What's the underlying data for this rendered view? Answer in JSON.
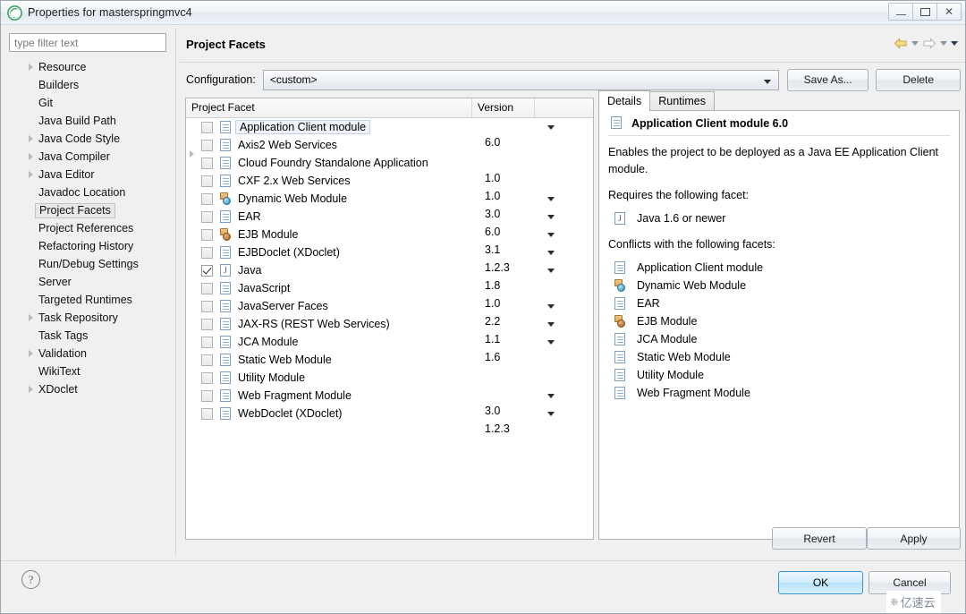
{
  "window": {
    "title": "Properties for masterspringmvc4",
    "app_icon": "eclipse-icon",
    "controls": [
      {
        "name": "minimize-button",
        "glyph": "minimize"
      },
      {
        "name": "maximize-button",
        "glyph": "maximize"
      },
      {
        "name": "close-button",
        "glyph": "close"
      }
    ]
  },
  "sidebar": {
    "filter": {
      "placeholder": "type filter text",
      "value": ""
    },
    "items": [
      {
        "label": "Resource",
        "expandable": true,
        "selected": false
      },
      {
        "label": "Builders",
        "expandable": false,
        "selected": false
      },
      {
        "label": "Git",
        "expandable": false,
        "selected": false
      },
      {
        "label": "Java Build Path",
        "expandable": false,
        "selected": false
      },
      {
        "label": "Java Code Style",
        "expandable": true,
        "selected": false
      },
      {
        "label": "Java Compiler",
        "expandable": true,
        "selected": false
      },
      {
        "label": "Java Editor",
        "expandable": true,
        "selected": false
      },
      {
        "label": "Javadoc Location",
        "expandable": false,
        "selected": false
      },
      {
        "label": "Project Facets",
        "expandable": false,
        "selected": true
      },
      {
        "label": "Project References",
        "expandable": false,
        "selected": false
      },
      {
        "label": "Refactoring History",
        "expandable": false,
        "selected": false
      },
      {
        "label": "Run/Debug Settings",
        "expandable": false,
        "selected": false
      },
      {
        "label": "Server",
        "expandable": false,
        "selected": false
      },
      {
        "label": "Targeted Runtimes",
        "expandable": false,
        "selected": false
      },
      {
        "label": "Task Repository",
        "expandable": true,
        "selected": false
      },
      {
        "label": "Task Tags",
        "expandable": false,
        "selected": false
      },
      {
        "label": "Validation",
        "expandable": true,
        "selected": false
      },
      {
        "label": "WikiText",
        "expandable": false,
        "selected": false
      },
      {
        "label": "XDoclet",
        "expandable": true,
        "selected": false
      }
    ]
  },
  "page": {
    "title": "Project Facets",
    "nav": {
      "back_icon": "back-arrow-icon",
      "back_menu_icon": "chevron-down-icon",
      "forward_icon": "forward-arrow-icon",
      "forward_menu_icon": "chevron-down-icon",
      "view_menu_icon": "chevron-down-icon"
    },
    "configuration": {
      "label": "Configuration:",
      "value": "<custom>",
      "save_as_label": "Save As...",
      "delete_label": "Delete"
    }
  },
  "facet_table": {
    "columns": [
      "Project Facet",
      "Version",
      ""
    ],
    "rows": [
      {
        "name": "Application Client module",
        "version": "6.0",
        "checked": false,
        "icon": "doc",
        "dropdown": true,
        "expandable": false,
        "selected": true
      },
      {
        "name": "Axis2 Web Services",
        "version": "",
        "checked": false,
        "icon": "doc",
        "dropdown": false,
        "expandable": true,
        "selected": false
      },
      {
        "name": "Cloud Foundry Standalone Application",
        "version": "1.0",
        "checked": false,
        "icon": "doc",
        "dropdown": false,
        "expandable": false,
        "selected": false
      },
      {
        "name": "CXF 2.x Web Services",
        "version": "1.0",
        "checked": false,
        "icon": "doc",
        "dropdown": false,
        "expandable": false,
        "selected": false
      },
      {
        "name": "Dynamic Web Module",
        "version": "3.0",
        "checked": false,
        "icon": "web",
        "dropdown": true,
        "expandable": false,
        "selected": false
      },
      {
        "name": "EAR",
        "version": "6.0",
        "checked": false,
        "icon": "doc",
        "dropdown": true,
        "expandable": false,
        "selected": false
      },
      {
        "name": "EJB Module",
        "version": "3.1",
        "checked": false,
        "icon": "ejb",
        "dropdown": true,
        "expandable": false,
        "selected": false
      },
      {
        "name": "EJBDoclet (XDoclet)",
        "version": "1.2.3",
        "checked": false,
        "icon": "doc",
        "dropdown": true,
        "expandable": false,
        "selected": false
      },
      {
        "name": "Java",
        "version": "1.8",
        "checked": true,
        "icon": "java",
        "dropdown": true,
        "expandable": false,
        "selected": false
      },
      {
        "name": "JavaScript",
        "version": "1.0",
        "checked": false,
        "icon": "doc",
        "dropdown": false,
        "expandable": false,
        "selected": false
      },
      {
        "name": "JavaServer Faces",
        "version": "2.2",
        "checked": false,
        "icon": "doc",
        "dropdown": true,
        "expandable": false,
        "selected": false
      },
      {
        "name": "JAX-RS (REST Web Services)",
        "version": "1.1",
        "checked": false,
        "icon": "doc",
        "dropdown": true,
        "expandable": false,
        "selected": false
      },
      {
        "name": "JCA Module",
        "version": "1.6",
        "checked": false,
        "icon": "doc",
        "dropdown": true,
        "expandable": false,
        "selected": false
      },
      {
        "name": "Static Web Module",
        "version": "",
        "checked": false,
        "icon": "doc",
        "dropdown": false,
        "expandable": false,
        "selected": false
      },
      {
        "name": "Utility Module",
        "version": "",
        "checked": false,
        "icon": "doc",
        "dropdown": false,
        "expandable": false,
        "selected": false
      },
      {
        "name": "Web Fragment Module",
        "version": "3.0",
        "checked": false,
        "icon": "doc",
        "dropdown": true,
        "expandable": false,
        "selected": false
      },
      {
        "name": "WebDoclet (XDoclet)",
        "version": "1.2.3",
        "checked": false,
        "icon": "doc",
        "dropdown": true,
        "expandable": false,
        "selected": false
      }
    ]
  },
  "details": {
    "tabs": [
      {
        "label": "Details",
        "active": true
      },
      {
        "label": "Runtimes",
        "active": false
      }
    ],
    "heading": "Application Client module 6.0",
    "heading_icon": "doc",
    "description": "Enables the project to be deployed as a Java EE Application Client module.",
    "requires_label": "Requires the following facet:",
    "requires": [
      {
        "label": "Java 1.6 or newer",
        "icon": "java"
      }
    ],
    "conflicts_label": "Conflicts with the following facets:",
    "conflicts": [
      {
        "label": "Application Client module",
        "icon": "doc"
      },
      {
        "label": "Dynamic Web Module",
        "icon": "web"
      },
      {
        "label": "EAR",
        "icon": "doc"
      },
      {
        "label": "EJB Module",
        "icon": "ejb"
      },
      {
        "label": "JCA Module",
        "icon": "doc"
      },
      {
        "label": "Static Web Module",
        "icon": "doc"
      },
      {
        "label": "Utility Module",
        "icon": "doc"
      },
      {
        "label": "Web Fragment Module",
        "icon": "doc"
      }
    ]
  },
  "footer": {
    "revert_label": "Revert",
    "apply_label": "Apply",
    "help_icon": "help-icon",
    "help_glyph": "?",
    "ok_label": "OK",
    "cancel_label": "Cancel"
  },
  "watermark": {
    "text": "亿速云",
    "logo": "cloud-logo"
  },
  "colors": {
    "accent": "#3c94d4",
    "selection": "#eef3f9",
    "window_bg": "#f0f0f0"
  }
}
